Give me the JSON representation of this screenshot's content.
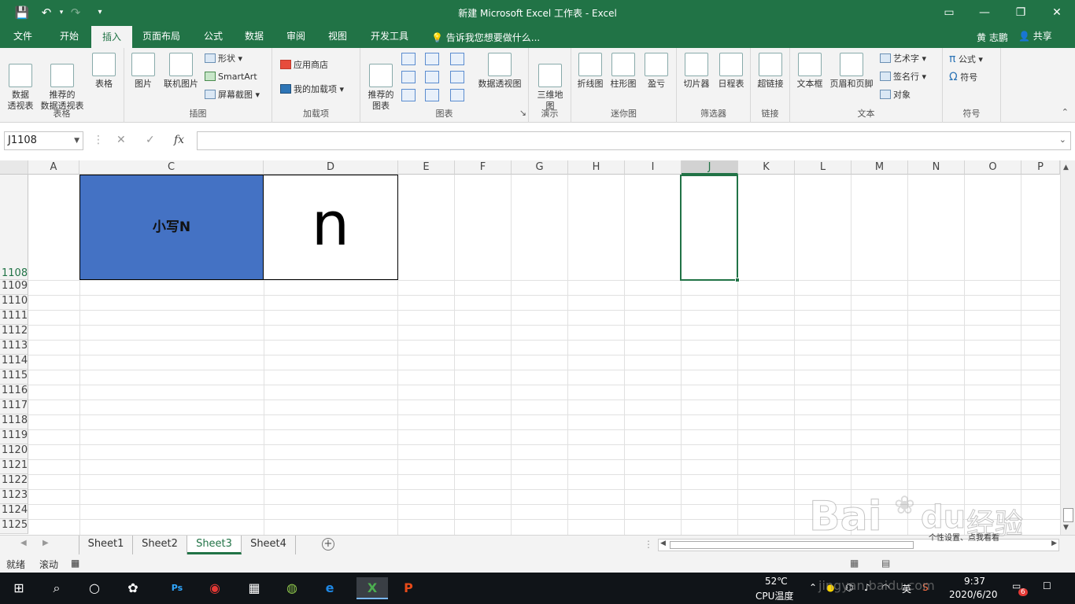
{
  "window": {
    "title": "新建 Microsoft Excel 工作表 - Excel",
    "minimize": "—",
    "restore": "❐",
    "close": "✕",
    "ribbon_display": "▭"
  },
  "quick_access": {
    "save": "💾",
    "undo": "↶",
    "redo": "↷",
    "customize": "▾"
  },
  "tabs": [
    {
      "label": "文件"
    },
    {
      "label": "开始"
    },
    {
      "label": "插入",
      "active": true
    },
    {
      "label": "页面布局"
    },
    {
      "label": "公式"
    },
    {
      "label": "数据"
    },
    {
      "label": "审阅"
    },
    {
      "label": "视图"
    },
    {
      "label": "开发工具"
    }
  ],
  "tell_me": "告诉我您想要做什么...",
  "user": "黄 志鹏",
  "share": "共享",
  "ribbon": {
    "groups": {
      "tables": {
        "label": "表格",
        "pivot": "数据\n透视表",
        "rec_pivot": "推荐的\n数据透视表",
        "table": "表格"
      },
      "illustrations": {
        "label": "插图",
        "pictures": "图片",
        "online_pictures": "联机图片",
        "shapes": "形状",
        "smartart": "SmartArt",
        "screenshot": "屏幕截图"
      },
      "addins": {
        "label": "加载项",
        "store": "应用商店",
        "my_addins": "我的加载项"
      },
      "charts": {
        "label": "图表",
        "recommended": "推荐的\n图表",
        "pivot_chart": "数据透视图"
      },
      "tours": {
        "label": "演示",
        "map3d": "三维地\n图"
      },
      "sparklines": {
        "label": "迷你图",
        "line": "折线图",
        "column": "柱形图",
        "winloss": "盈亏"
      },
      "filters": {
        "label": "筛选器",
        "slicer": "切片器",
        "timeline": "日程表"
      },
      "links": {
        "label": "链接",
        "hyperlink": "超链接"
      },
      "text": {
        "label": "文本",
        "textbox": "文本框",
        "header_footer": "页眉和页脚",
        "wordart": "艺术字",
        "signature": "签名行",
        "object": "对象"
      },
      "symbols": {
        "label": "符号",
        "equation": "公式",
        "symbol": "符号"
      }
    }
  },
  "formula_bar": {
    "name_box": "J1108",
    "cancel": "✕",
    "enter": "✓",
    "fx": "fx",
    "formula": ""
  },
  "columns": [
    "A",
    "C",
    "D",
    "E",
    "F",
    "G",
    "H",
    "I",
    "J",
    "K",
    "L",
    "M",
    "N",
    "O",
    "P"
  ],
  "rows": [
    "1108",
    "1109",
    "1110",
    "1111",
    "1112",
    "1113",
    "1114",
    "1115",
    "1116",
    "1117",
    "1118",
    "1119",
    "1120",
    "1121",
    "1122",
    "1123",
    "1124",
    "1125"
  ],
  "cells": {
    "C1108": "小写N",
    "D1108": "n"
  },
  "colors": {
    "excel_green": "#217346",
    "cell_fill": "#4472c4"
  },
  "sheets": [
    {
      "name": "Sheet1"
    },
    {
      "name": "Sheet2"
    },
    {
      "name": "Sheet3",
      "active": true
    },
    {
      "name": "Sheet4"
    }
  ],
  "add_sheet": "+",
  "status": {
    "ready": "就绪",
    "scroll": "滚动"
  },
  "taskbar": {
    "temperature": "52℃",
    "cpu": "CPU温度",
    "ime": "英",
    "time": "9:37",
    "date": "2020/6/20",
    "notif_count": "6"
  },
  "watermark": {
    "brand": "Bai",
    "brand2": "du",
    "jingyan": "经验",
    "domain": "jingyan.baidu.com",
    "sub": "个性设置、点我看看"
  }
}
